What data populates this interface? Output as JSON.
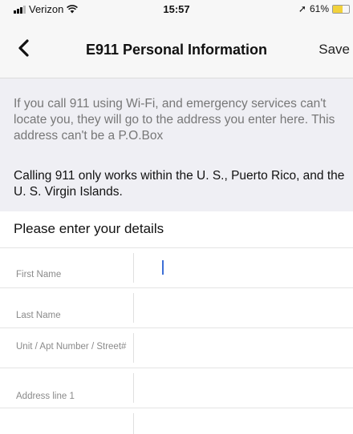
{
  "status_bar": {
    "carrier": "Verizon",
    "time": "15:57",
    "battery_percent": "61%",
    "battery_level": 0.61,
    "battery_color": "#f2d23b",
    "icons": [
      "signal-icon",
      "wifi-icon",
      "location-arrow-icon",
      "battery-icon"
    ]
  },
  "nav": {
    "title": "E911 Personal Information",
    "save_label": "Save",
    "back_icon": "chevron-left-icon"
  },
  "info": {
    "wifi_notice": "If you call 911 using Wi-Fi, and emergency services can't locate you, they will go to the address you enter here. This address can't be a P.O.Box",
    "coverage_notice": "Calling 911 only works within the U. S., Puerto Rico, and the U. S. Virgin Islands."
  },
  "details": {
    "header": "Please enter your details"
  },
  "form": {
    "first_name_label": "First Name",
    "first_name_value": "",
    "last_name_label": "Last Name",
    "last_name_value": "",
    "street_label": "Unit / Apt Number / Street#",
    "street_value": "",
    "address1_label": "Address line 1",
    "address1_value": ""
  },
  "colors": {
    "cursor": "#3d6fd6",
    "section_background": "#efeff4"
  }
}
